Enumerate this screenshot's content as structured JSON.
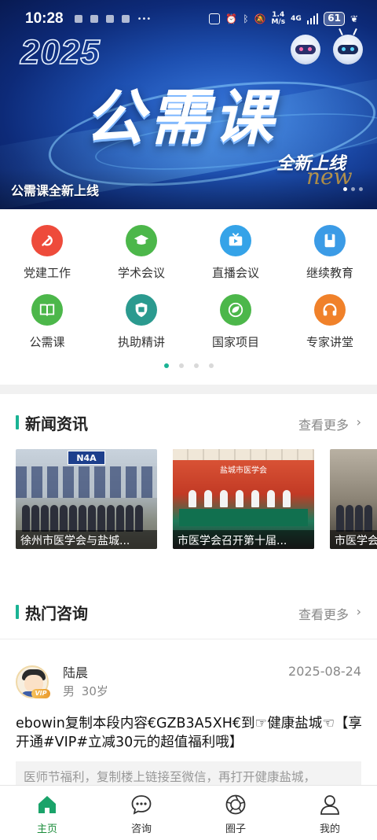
{
  "status_bar": {
    "time": "10:28",
    "network_speed": "1.4\nM/s",
    "network_type": "4G",
    "battery": "61"
  },
  "banner": {
    "year": "2025",
    "title": "公需课",
    "subtitle": "全新上线",
    "decor_word": "new",
    "caption": "公需课全新上线",
    "slide_count": 3,
    "active_slide": 0
  },
  "grid": {
    "items": [
      {
        "label": "党建工作",
        "icon": "party-emblem-icon",
        "color": "#ee4b3b"
      },
      {
        "label": "学术会议",
        "icon": "graduation-cap-icon",
        "color": "#4cb74a"
      },
      {
        "label": "直播会议",
        "icon": "tv-play-icon",
        "color": "#35a3e8"
      },
      {
        "label": "继续教育",
        "icon": "book-icon",
        "color": "#3b9be6"
      },
      {
        "label": "公需课",
        "icon": "open-book-icon",
        "color": "#4cb74a"
      },
      {
        "label": "执助精讲",
        "icon": "certificate-shield-icon",
        "color": "#2b9a8f"
      },
      {
        "label": "国家项目",
        "icon": "leaf-globe-icon",
        "color": "#4cb74a"
      },
      {
        "label": "专家讲堂",
        "icon": "headphones-icon",
        "color": "#f0812a"
      }
    ],
    "page_count": 4,
    "active_page": 0
  },
  "news": {
    "title": "新闻资讯",
    "more": "查看更多",
    "items": [
      {
        "caption": "徐州市医学会与盐城...",
        "sign": "N4A"
      },
      {
        "caption": "市医学会召开第十届...",
        "sign": "盐城市医学会"
      },
      {
        "caption": "市医学会..."
      }
    ]
  },
  "hot": {
    "title": "热门咨询",
    "more": "查看更多",
    "post": {
      "user": "陆晨",
      "gender": "男",
      "age": "30岁",
      "vip": "VIP",
      "date": "2025-08-24",
      "text": "ebowin复制本段内容€GZB3A5XH€到☞健康盐城☜【享\n开通#VIP#立减30元的超值福利哦】",
      "reply": "医师节福利，复制楼上链接至微信，再打开健康盐城，"
    }
  },
  "bottom_nav": {
    "items": [
      {
        "label": "主页",
        "icon": "home-icon",
        "active": true
      },
      {
        "label": "咨询",
        "icon": "chat-bubble-icon",
        "active": false
      },
      {
        "label": "圈子",
        "icon": "aperture-icon",
        "active": false
      },
      {
        "label": "我的",
        "icon": "person-icon",
        "active": false
      }
    ],
    "active_color": "#1a8c3a",
    "accent": "#1ab394"
  }
}
